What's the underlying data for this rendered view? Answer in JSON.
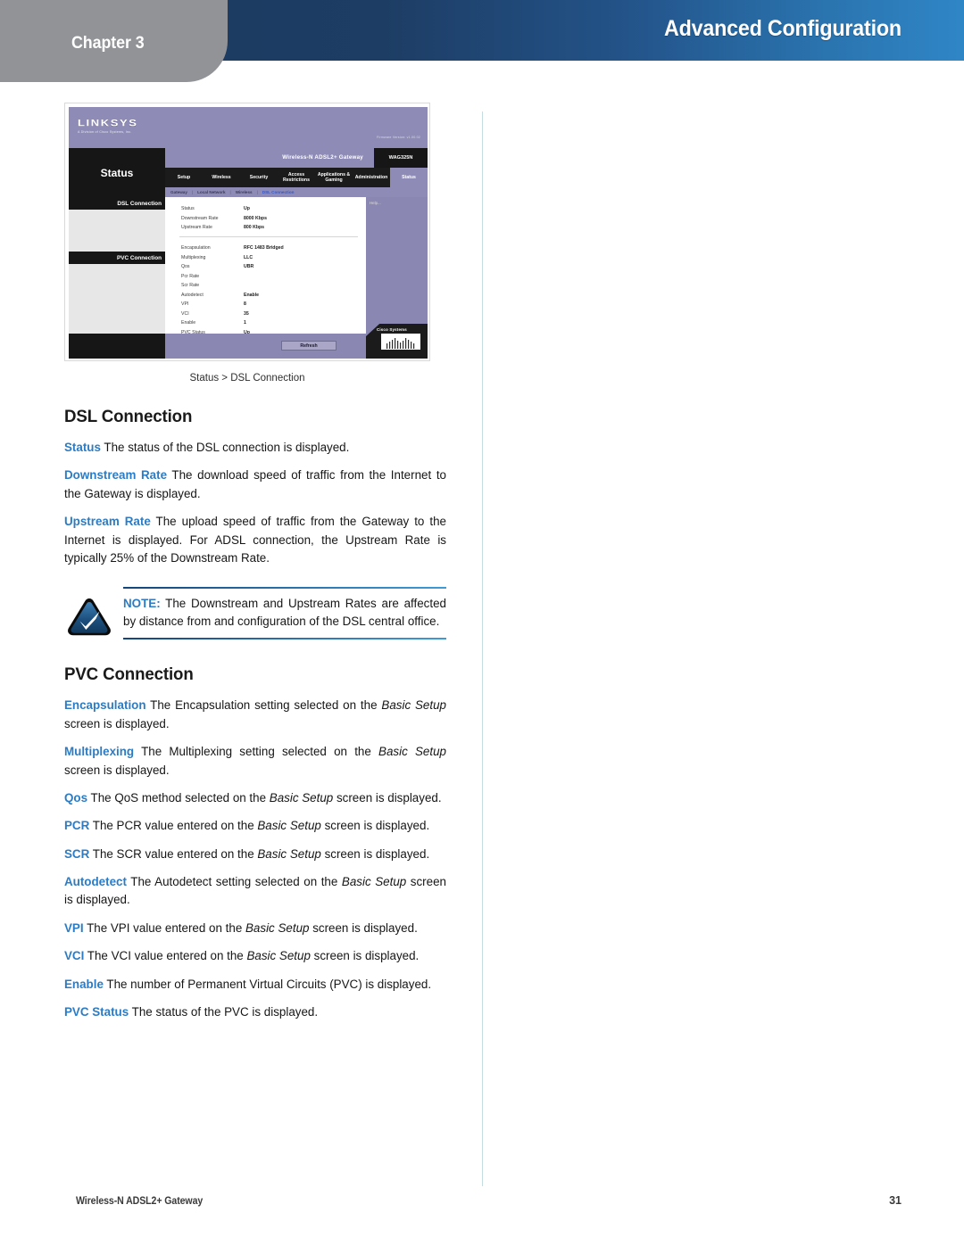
{
  "header": {
    "chapter_label": "Chapter 3",
    "title": "Advanced Configuration"
  },
  "figure": {
    "caption": "Status > DSL Connection",
    "router_ui": {
      "brand": "LINKSYS",
      "brand_sub": "A Division of Cisco Systems, Inc.",
      "firmware_version": "Firmware Version: v1.00.02",
      "section_title": "Status",
      "model_text": "Wireless-N ADSL2+ Gateway",
      "model_number": "WAG325N",
      "nav_items": [
        "Setup",
        "Wireless",
        "Security",
        "Access Restrictions",
        "Applications & Gaming",
        "Administration",
        "Status"
      ],
      "nav_active": "Status",
      "subnav_items": [
        "Gateway",
        "Local Network",
        "Wireless",
        "DSL Connection"
      ],
      "subnav_active": "DSL Connection",
      "panel_labels": [
        "DSL Connection",
        "PVC Connection"
      ],
      "help_label": "Help...",
      "dsl_rows": [
        {
          "label": "Status",
          "value": "Up"
        },
        {
          "label": "Downstream Rate",
          "value": "8000 Kbps"
        },
        {
          "label": "Upstream Rate",
          "value": "800 Kbps"
        }
      ],
      "pvc_rows": [
        {
          "label": "Encapsulation",
          "value": "RFC 1483 Bridged"
        },
        {
          "label": "Multiplexing",
          "value": "LLC"
        },
        {
          "label": "Qos",
          "value": "UBR"
        },
        {
          "label": "Pcr Rate",
          "value": ""
        },
        {
          "label": "Scr Rate",
          "value": ""
        },
        {
          "label": "Autodetect",
          "value": "Enable"
        },
        {
          "label": "VPI",
          "value": "8"
        },
        {
          "label": "VCI",
          "value": "35"
        },
        {
          "label": "Enable",
          "value": "1"
        },
        {
          "label": "PVC Status",
          "value": "Up"
        }
      ],
      "refresh_button": "Refresh",
      "cisco_label": "Cisco Systems"
    }
  },
  "sections": {
    "dsl": {
      "heading": "DSL Connection",
      "paragraphs": [
        {
          "term": "Status",
          "parts": [
            {
              "type": "text",
              "text": " The status of the DSL connection is displayed."
            }
          ]
        },
        {
          "term": "Downstream Rate",
          "parts": [
            {
              "type": "text",
              "text": " The download speed of traffic from the Internet to the Gateway is displayed."
            }
          ]
        },
        {
          "term": "Upstream Rate",
          "parts": [
            {
              "type": "text",
              "text": " The upload speed of traffic from the Gateway to the Internet is displayed. For ADSL connection, the Upstream Rate is typically 25% of the Downstream Rate."
            }
          ]
        }
      ]
    },
    "note": {
      "keyword": "NOTE:",
      "text": " The Downstream and Upstream Rates are affected by distance from and configuration of the DSL central office."
    },
    "pvc": {
      "heading": "PVC Connection",
      "paragraphs": [
        {
          "term": "Encapsulation",
          "parts": [
            {
              "type": "text",
              "text": " The Encapsulation setting selected on the "
            },
            {
              "type": "italic",
              "text": "Basic Setup"
            },
            {
              "type": "text",
              "text": " screen is displayed."
            }
          ]
        },
        {
          "term": "Multiplexing",
          "parts": [
            {
              "type": "text",
              "text": " The Multiplexing setting selected on the "
            },
            {
              "type": "italic",
              "text": "Basic Setup"
            },
            {
              "type": "text",
              "text": " screen is displayed."
            }
          ]
        },
        {
          "term": "Qos",
          "parts": [
            {
              "type": "text",
              "text": " The QoS method selected on the "
            },
            {
              "type": "italic",
              "text": "Basic Setup"
            },
            {
              "type": "text",
              "text": " screen is displayed."
            }
          ]
        },
        {
          "term": "PCR",
          "parts": [
            {
              "type": "text",
              "text": " The PCR value entered on the "
            },
            {
              "type": "italic",
              "text": "Basic Setup"
            },
            {
              "type": "text",
              "text": " screen is displayed."
            }
          ]
        },
        {
          "term": "SCR",
          "parts": [
            {
              "type": "text",
              "text": "  The SCR value entered on the "
            },
            {
              "type": "italic",
              "text": "Basic Setup"
            },
            {
              "type": "text",
              "text": " screen is displayed."
            }
          ]
        },
        {
          "term": "Autodetect",
          "parts": [
            {
              "type": "text",
              "text": " The Autodetect setting selected on the "
            },
            {
              "type": "italic",
              "text": "Basic Setup"
            },
            {
              "type": "text",
              "text": " screen is displayed."
            }
          ]
        },
        {
          "term": "VPI",
          "parts": [
            {
              "type": "text",
              "text": " The VPI value entered on the "
            },
            {
              "type": "italic",
              "text": "Basic Setup"
            },
            {
              "type": "text",
              "text": " screen is displayed."
            }
          ]
        },
        {
          "term": "VCI",
          "parts": [
            {
              "type": "text",
              "text": " The VCI value entered on the "
            },
            {
              "type": "italic",
              "text": "Basic Setup"
            },
            {
              "type": "text",
              "text": " screen is displayed."
            }
          ]
        },
        {
          "term": "Enable",
          "parts": [
            {
              "type": "text",
              "text": " The number of Permanent Virtual Circuits (PVC) is displayed."
            }
          ]
        },
        {
          "term": "PVC Status",
          "parts": [
            {
              "type": "text",
              "text": " The status of the PVC is displayed."
            }
          ]
        }
      ]
    }
  },
  "footer": {
    "left": "Wireless-N ADSL2+ Gateway",
    "page_number": "31"
  },
  "colors": {
    "term_blue": "#2b7cc4",
    "header_dark": "#1b3a60",
    "header_light": "#2f86c6",
    "chapter_gray": "#919396",
    "divider": "#c5dde2"
  }
}
